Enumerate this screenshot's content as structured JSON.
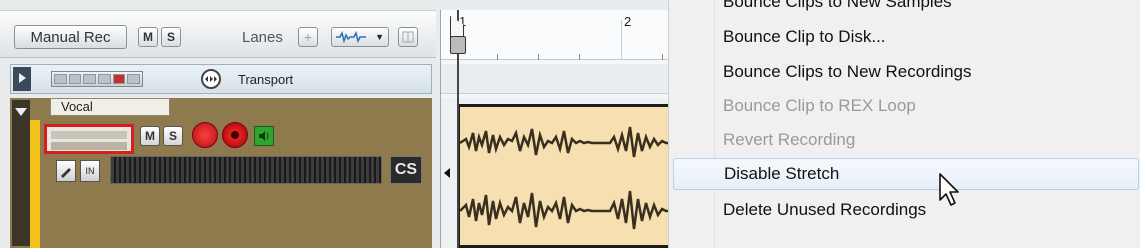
{
  "toolbar": {
    "manual_rec_label": "Manual Rec",
    "m_label": "M",
    "s_label": "S",
    "lanes_label": "Lanes",
    "lanes_plus": "+",
    "lanes_dropdown_arrow": "▼"
  },
  "transport_track": {
    "label": "Transport"
  },
  "vocal_track": {
    "name": "Vocal",
    "m_label": "M",
    "s_label": "S",
    "in_label": "IN",
    "cs_label": "CS"
  },
  "ruler": {
    "bar1": "1",
    "bar2": "2"
  },
  "context_menu": {
    "items": [
      {
        "label": "Bounce Clips to New Samples",
        "state": "partial"
      },
      {
        "label": "Bounce Clip to Disk...",
        "state": "enabled"
      },
      {
        "label": "Bounce Clips to New Recordings",
        "state": "enabled"
      },
      {
        "label": "Bounce Clip to REX Loop",
        "state": "disabled"
      },
      {
        "label": "Revert Recording",
        "state": "disabled"
      },
      {
        "label": "Disable Stretch",
        "state": "hover"
      },
      {
        "label": "Delete Unused Recordings",
        "state": "enabled"
      }
    ]
  },
  "colors": {
    "track_color": "#f2c21a",
    "record_red": "#d71f1f",
    "clip_fill": "#f6dfb0",
    "menu_hover": "#e6eff8"
  },
  "icons": [
    "transport-icon",
    "record-arm-icon",
    "monitor-icon",
    "speaker-icon",
    "mouse-cursor-icon",
    "playhead-icon"
  ]
}
